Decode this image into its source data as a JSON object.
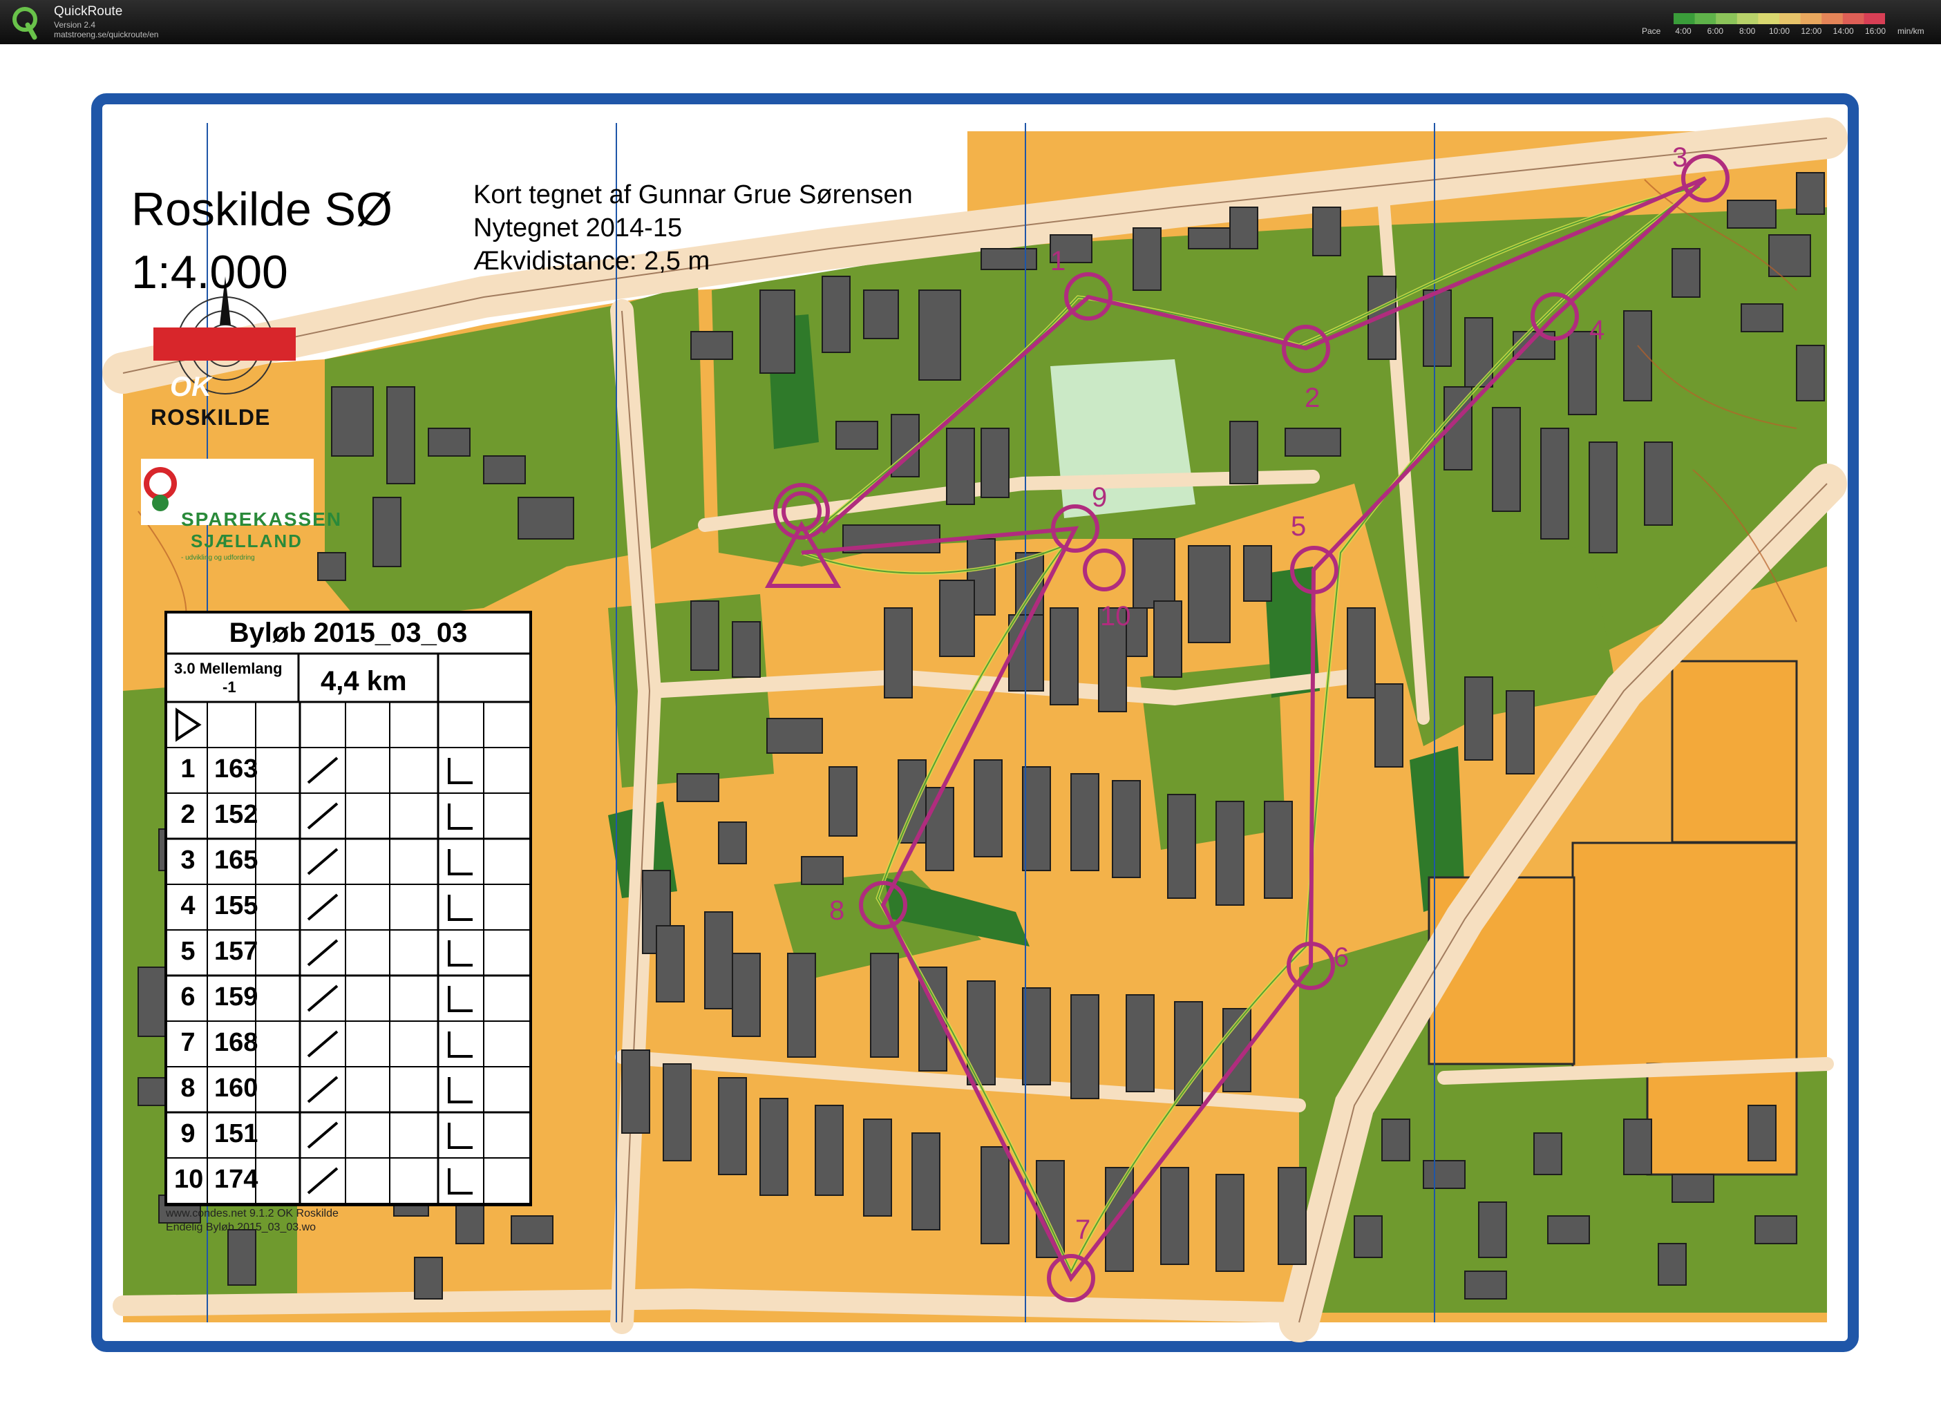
{
  "app": {
    "name": "QuickRoute",
    "version": "Version 2.4",
    "url": "matstroeng.se/quickroute/en"
  },
  "pace_legend": {
    "label": "Pace",
    "ticks": [
      "4:00",
      "6:00",
      "8:00",
      "10:00",
      "12:00",
      "14:00",
      "16:00"
    ],
    "unit": "min/km",
    "colors": [
      "#3a9d3a",
      "#5fb34a",
      "#8cc45a",
      "#b8d26a",
      "#d9d870",
      "#e7c46a",
      "#e9a85e",
      "#e58558",
      "#de5f56",
      "#d83f55"
    ]
  },
  "map": {
    "title": "Roskilde SØ",
    "scale": "1:4.000",
    "credits": [
      "Kort tegnet af Gunnar Grue Sørensen",
      "Nytegnet 2014-15",
      "Ækvidistance: 2,5 m"
    ],
    "club": "ROSKILDE",
    "club_mark": "OK",
    "sponsor": {
      "line1": "SPAREKASSEN",
      "line2": "SJÆLLAND",
      "tagline": "- udvikling og udfordring"
    },
    "colors": {
      "open": "#f3b24a",
      "forest": "#6f9a2e",
      "green": "#2f7a2a",
      "building": "#555555",
      "paved": "#f6dfc0",
      "course": "#b02c7e",
      "frame": "#1f56a8"
    }
  },
  "course": {
    "name": "Byløb 2015_03_03",
    "class_line1": "3.0 Mellemlang",
    "class_line2": "-1",
    "length": "4,4 km",
    "controls": [
      {
        "num": "1",
        "code": "163"
      },
      {
        "num": "2",
        "code": "152"
      },
      {
        "num": "3",
        "code": "165"
      },
      {
        "num": "4",
        "code": "155"
      },
      {
        "num": "5",
        "code": "157"
      },
      {
        "num": "6",
        "code": "159"
      },
      {
        "num": "7",
        "code": "168"
      },
      {
        "num": "8",
        "code": "160"
      },
      {
        "num": "9",
        "code": "151"
      },
      {
        "num": "10",
        "code": "174"
      }
    ],
    "footer1": "www.condes.net 9.1.2 OK Roskilde",
    "footer2": "Endelig Byløb 2015_03_03.wo",
    "map_labels": [
      "1",
      "2",
      "3",
      "4",
      "5",
      "6",
      "7",
      "8",
      "9",
      "10"
    ]
  }
}
